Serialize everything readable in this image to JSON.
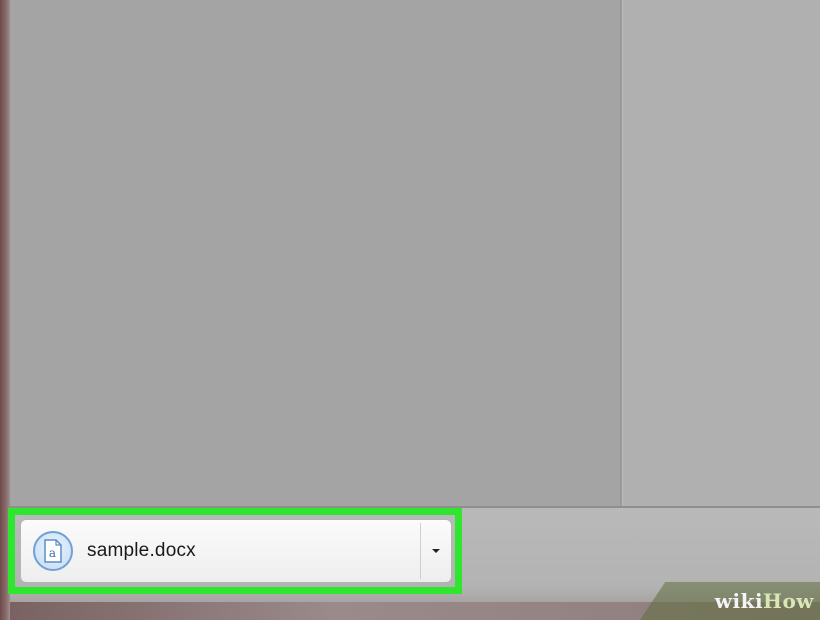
{
  "download_shelf": {
    "item": {
      "file_name": "sample.docx",
      "icon": "document-file-icon",
      "menu_icon": "chevron-down-icon"
    },
    "highlight_color": "#2ee62e"
  },
  "watermark": {
    "part1": "wiki",
    "part2": "How"
  }
}
